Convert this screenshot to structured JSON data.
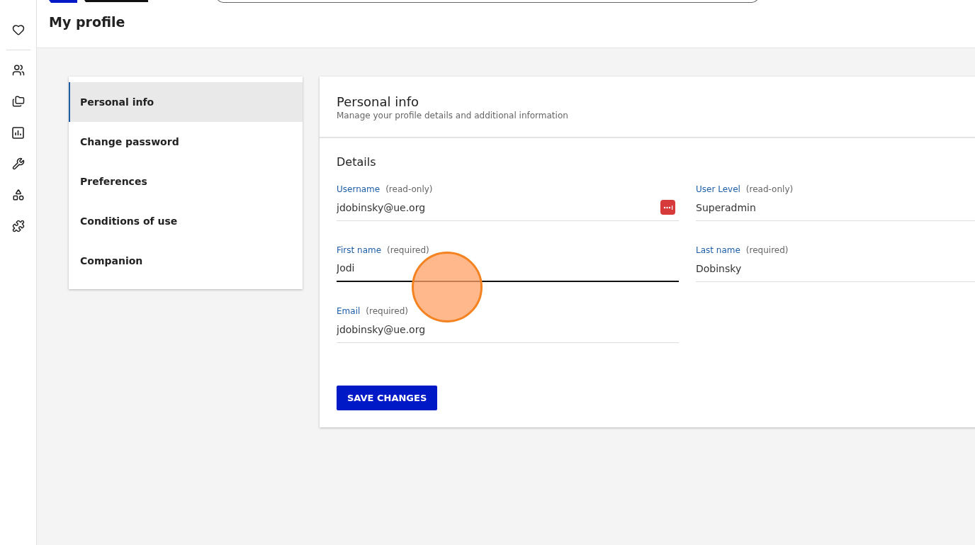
{
  "page_title": "My profile",
  "rail_items": [
    {
      "kind": "heart"
    },
    {
      "kind": "divider"
    },
    {
      "kind": "people"
    },
    {
      "kind": "folder"
    },
    {
      "kind": "chart"
    },
    {
      "kind": "wrench"
    },
    {
      "kind": "shapes"
    },
    {
      "kind": "puzzle"
    }
  ],
  "nav": [
    {
      "label": "Personal info",
      "selected": true
    },
    {
      "label": "Change password",
      "selected": false
    },
    {
      "label": "Preferences",
      "selected": false
    },
    {
      "label": "Conditions of use",
      "selected": false
    },
    {
      "label": "Companion",
      "selected": false
    }
  ],
  "panel": {
    "title": "Personal info",
    "subtitle": "Manage your profile details and additional information",
    "section": "Details",
    "fields": [
      {
        "label": "Username",
        "note": "(read-only)",
        "value": "jdobinsky@ue.org",
        "kind": "autofill",
        "focused": false
      },
      {
        "label": "User Level",
        "note": "(read-only)",
        "value": "Superadmin",
        "kind": "plain",
        "focused": false
      },
      {
        "label": "First name",
        "note": "(required)",
        "value": "Jodi",
        "kind": "plain",
        "focused": true
      },
      {
        "label": "Last name",
        "note": "(required)",
        "value": "Dobinsky",
        "kind": "plain",
        "focused": false
      },
      {
        "label": "Email",
        "note": "(required)",
        "value": "jdobinsky@ue.org",
        "kind": "plain",
        "focused": false
      }
    ],
    "button": "SAVE CHANGES"
  }
}
